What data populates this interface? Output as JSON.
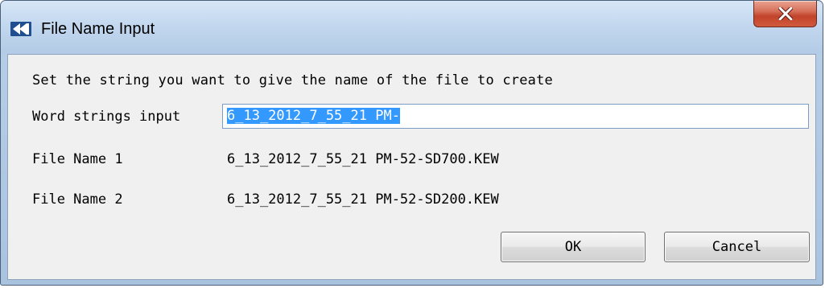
{
  "window": {
    "title": "File Name Input",
    "icon": "app-logo-icon",
    "close_icon": "close-icon"
  },
  "dialog": {
    "instruction": "Set the string you want to give the name of the file to create",
    "word_strings_label": "Word strings input",
    "word_strings_value": "6_13_2012_7_55_21 PM-",
    "file_name_1_label": "File Name 1",
    "file_name_1_value": "6_13_2012_7_55_21 PM-52-SD700.KEW",
    "file_name_2_label": "File Name 2",
    "file_name_2_value": "6_13_2012_7_55_21 PM-52-SD200.KEW"
  },
  "buttons": {
    "ok_label": "OK",
    "cancel_label": "Cancel"
  },
  "colors": {
    "selection": "#3399ff",
    "close_button": "#c2432a",
    "title_bar": "#c3d8ef"
  }
}
